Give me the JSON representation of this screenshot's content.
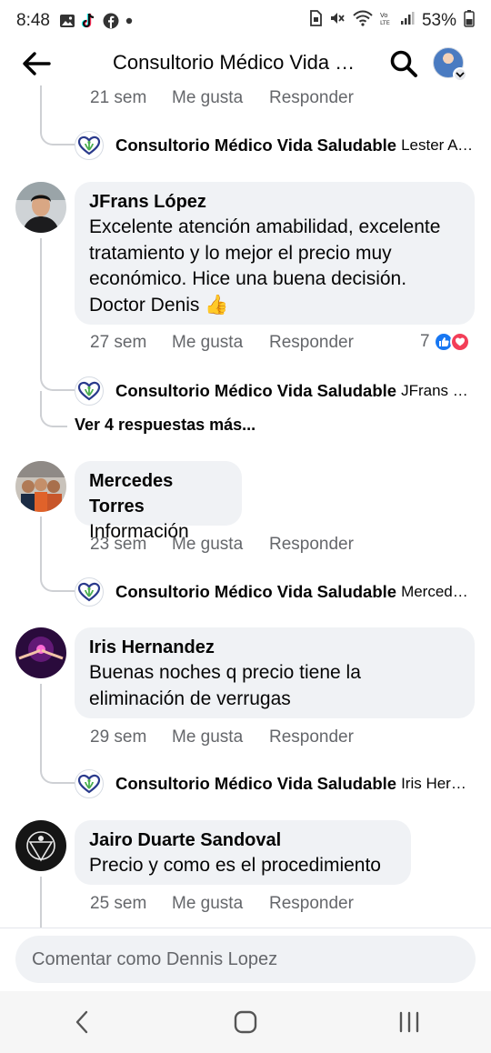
{
  "status_bar": {
    "time": "8:48",
    "battery": "53%",
    "icons": [
      "gallery-icon",
      "tiktok-icon",
      "facebook-icon",
      "dot-icon",
      "sim-icon",
      "mute-icon",
      "wifi-icon",
      "volte-icon",
      "signal-icon",
      "battery-icon"
    ]
  },
  "header": {
    "title": "Consultorio Médico Vida Saludable",
    "icons": [
      "back-arrow-icon",
      "search-icon",
      "avatar",
      "chevron-down-icon"
    ]
  },
  "actions_labels": {
    "like": "Me gusta",
    "reply": "Responder"
  },
  "top_fragment": {
    "age": "21 sem",
    "reply_preview": {
      "name": "Consultorio Médico Vida Saludable",
      "snippet": "Lester Ayala"
    }
  },
  "comments": [
    {
      "author": "JFrans López",
      "text": "Excelente atención amabilidad, excelente tratamiento y lo mejor el precio muy económico. Hice una buena decisión. Doctor Denis 👍",
      "age": "27 sem",
      "reaction_count": "7",
      "reaction_icons": [
        "like-reaction-icon",
        "love-reaction-icon"
      ],
      "reply_preview": {
        "name": "Consultorio Médico Vida Saludable",
        "snippet": "JFrans López"
      },
      "more_replies": "Ver 4 respuestas más..."
    },
    {
      "author": "Mercedes Torres",
      "text": "Información",
      "age": "23 sem",
      "reply_preview": {
        "name": "Consultorio Médico Vida Saludable",
        "snippet": "Mercedes Torres"
      }
    },
    {
      "author": "Iris Hernandez",
      "text": "Buenas noches q precio tiene la eliminación de verrugas",
      "age": "29 sem",
      "reply_preview": {
        "name": "Consultorio Médico Vida Saludable",
        "snippet": "Iris Hernandez"
      }
    },
    {
      "author": "Jairo Duarte Sandoval",
      "text": "Precio y como es el procedimiento",
      "age": "25 sem"
    }
  ],
  "composer": {
    "placeholder": "Comentar como Dennis Lopez"
  },
  "nav_bar": {
    "icons": [
      "back-nav-icon",
      "home-nav-icon",
      "recents-nav-icon"
    ]
  },
  "colors": {
    "bubble": "#f0f2f5",
    "secondary_text": "#65676b",
    "like_blue": "#1877f2",
    "love_red": "#f33e58",
    "thread_line": "#ced0d4"
  }
}
